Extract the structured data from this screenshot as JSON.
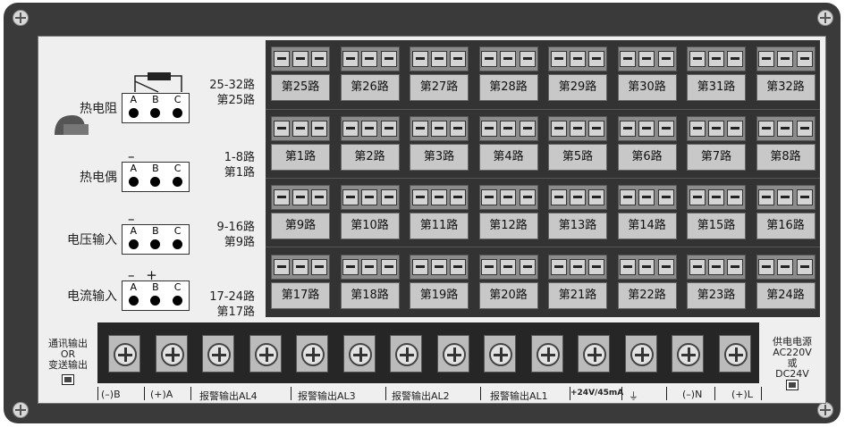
{
  "sensors": [
    {
      "label": "热电阻",
      "polarity": ""
    },
    {
      "label": "热电偶",
      "polarity": "– +"
    },
    {
      "label": "电压输入",
      "polarity": "– +"
    },
    {
      "label": "电流输入",
      "polarity": "–    +"
    }
  ],
  "abc": [
    "A",
    "B",
    "C"
  ],
  "ranges": [
    {
      "a": "25-32路",
      "b": "第25路"
    },
    {
      "a": "1-8路",
      "b": "第1路"
    },
    {
      "a": "9-16路",
      "b": "第9路"
    },
    {
      "a": "17-24路",
      "b": "第17路"
    }
  ],
  "channels": [
    [
      "第25路",
      "第26路",
      "第27路",
      "第28路",
      "第29路",
      "第30路",
      "第31路",
      "第32路"
    ],
    [
      "第1路",
      "第2路",
      "第3路",
      "第4路",
      "第5路",
      "第6路",
      "第7路",
      "第8路"
    ],
    [
      "第9路",
      "第10路",
      "第11路",
      "第12路",
      "第13路",
      "第14路",
      "第15路",
      "第16路"
    ],
    [
      "第17路",
      "第18路",
      "第19路",
      "第20路",
      "第21路",
      "第22路",
      "第23路",
      "第24路"
    ]
  ],
  "comm": {
    "l1": "通讯输出",
    "l2": "OR",
    "l3": "变送输出"
  },
  "power": {
    "l1": "供电电源",
    "l2": "AC220V",
    "l3": "或",
    "l4": "DC24V"
  },
  "bottom_labels": [
    "(–)B",
    "(+)A",
    "报警输出AL4",
    "报警输出AL3",
    "报警输出AL2",
    "报警输出AL1",
    "+24V/45mA",
    "⏚",
    "(–)N",
    "(+)L"
  ]
}
